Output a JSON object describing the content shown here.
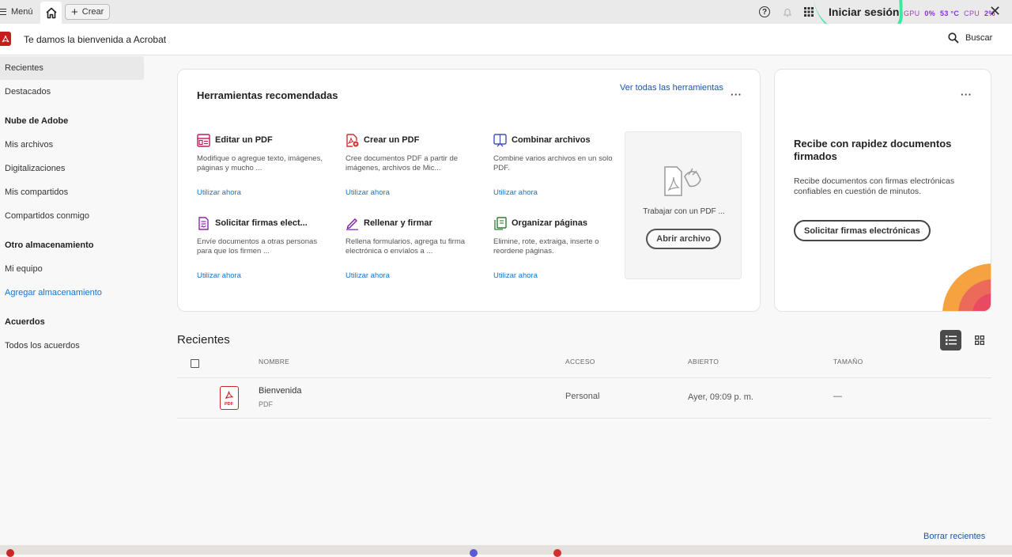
{
  "topbar": {
    "menu_label": "Menú",
    "create_label": "Crear",
    "login_label": "Iniciar sesión",
    "hud_gpu": "GPU",
    "hud_gpu_val": "0%",
    "hud_temp": "53 °C",
    "hud_cpu": "CPU",
    "hud_cpu_val": "2%"
  },
  "header": {
    "welcome": "Te damos la bienvenida a Acrobat",
    "search_label": "Buscar"
  },
  "sidebar": {
    "items": [
      {
        "label": "Recientes"
      },
      {
        "label": "Destacados"
      }
    ],
    "cloud_heading": "Nube de Adobe",
    "cloud_items": [
      {
        "label": "Mis archivos"
      },
      {
        "label": "Digitalizaciones"
      },
      {
        "label": "Mis compartidos"
      },
      {
        "label": "Compartidos conmigo"
      }
    ],
    "other_heading": "Otro almacenamiento",
    "other_items": [
      {
        "label": "Mi equipo"
      },
      {
        "label": "Agregar almacenamiento"
      }
    ],
    "agreements_heading": "Acuerdos",
    "agreements_items": [
      {
        "label": "Todos los acuerdos"
      }
    ]
  },
  "tools": {
    "title": "Herramientas recomendadas",
    "see_all": "Ver todas las herramientas",
    "items": [
      {
        "name": "Editar un PDF",
        "desc": "Modifique o agregue texto, imágenes, páginas y mucho ...",
        "link": "Utilizar ahora",
        "icon": "edit-pdf-icon",
        "color": "#c2185b"
      },
      {
        "name": "Crear un PDF",
        "desc": "Cree documentos PDF a partir de imágenes, archivos de Mic...",
        "link": "Utilizar ahora",
        "icon": "create-pdf-icon",
        "color": "#d32f2f"
      },
      {
        "name": "Combinar archivos",
        "desc": "Combine varios archivos en un solo PDF.",
        "link": "Utilizar ahora",
        "icon": "combine-files-icon",
        "color": "#3f51b5"
      },
      {
        "name": "Solicitar firmas elect...",
        "desc": "Envíe documentos a otras personas para que los firmen ...",
        "link": "Utilizar ahora",
        "icon": "request-signatures-icon",
        "color": "#8e24aa"
      },
      {
        "name": "Rellenar y firmar",
        "desc": "Rellena formularios, agrega tu firma electrónica o envíalos a ...",
        "link": "Utilizar ahora",
        "icon": "fill-sign-icon",
        "color": "#7b1fa2"
      },
      {
        "name": "Organizar páginas",
        "desc": "Elimine, rote, extraiga, inserte o reordene páginas.",
        "link": "Utilizar ahora",
        "icon": "organize-pages-icon",
        "color": "#2e7d32"
      }
    ],
    "open_box": {
      "text": "Trabajar con un PDF ...",
      "button": "Abrir archivo"
    }
  },
  "sign_card": {
    "title": "Recibe con rapidez documentos firmados",
    "desc": "Recibe documentos con firmas electrónicas confiables en cuestión de minutos.",
    "button": "Solicitar firmas electrónicas"
  },
  "recent": {
    "title": "Recientes",
    "columns": [
      "NOMBRE",
      "ACCESO",
      "ABIERTO",
      "TAMAÑO"
    ],
    "rows": [
      {
        "name": "Bienvenida",
        "type": "PDF",
        "access": "Personal",
        "opened": "Ayer, 09:09 p. m.",
        "size": "—"
      }
    ],
    "clear_label": "Borrar recientes"
  },
  "file_icon_label": "PDF",
  "colors": {
    "accent_link": "#1a73c8",
    "brand_red": "#c61c1c"
  }
}
